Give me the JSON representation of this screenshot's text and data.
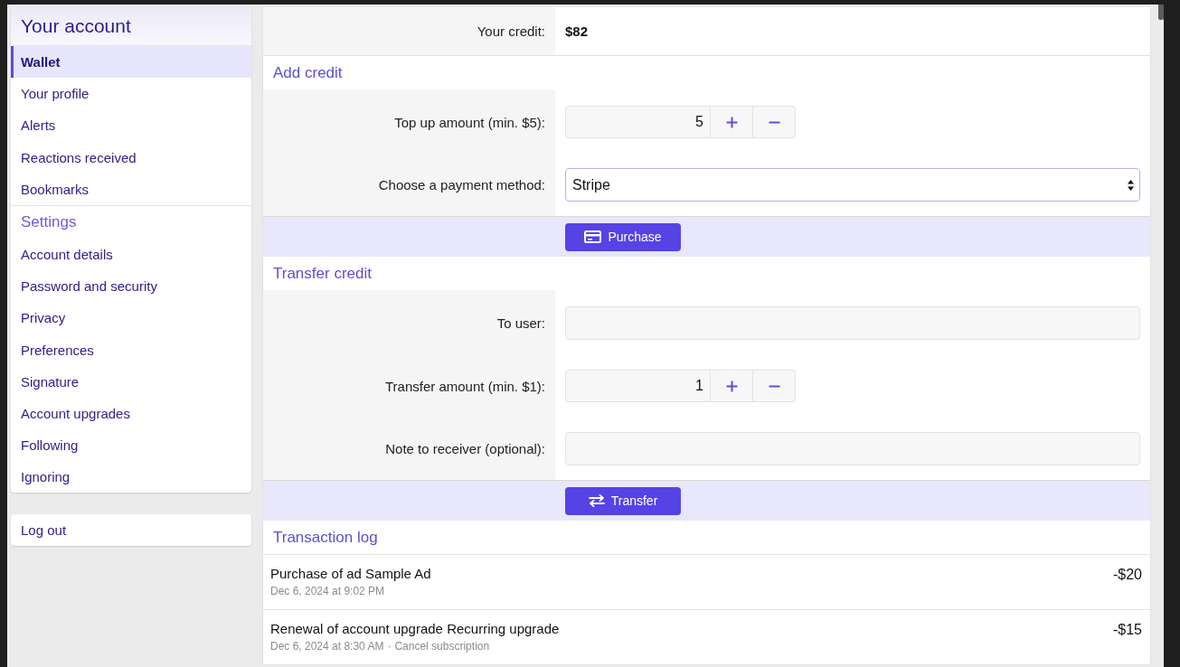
{
  "sidebar": {
    "sections": [
      {
        "kind": "title",
        "heading": "Your account",
        "items": [
          {
            "label": "Wallet",
            "selected": true
          },
          {
            "label": "Your profile",
            "selected": false
          },
          {
            "label": "Alerts",
            "selected": false
          },
          {
            "label": "Reactions received",
            "selected": false
          },
          {
            "label": "Bookmarks",
            "selected": false
          }
        ]
      },
      {
        "kind": "section",
        "heading": "Settings",
        "items": [
          {
            "label": "Account details",
            "selected": false
          },
          {
            "label": "Password and security",
            "selected": false
          },
          {
            "label": "Privacy",
            "selected": false
          },
          {
            "label": "Preferences",
            "selected": false
          },
          {
            "label": "Signature",
            "selected": false
          },
          {
            "label": "Account upgrades",
            "selected": false
          },
          {
            "label": "Following",
            "selected": false
          },
          {
            "label": "Ignoring",
            "selected": false
          }
        ]
      }
    ],
    "logout": "Log out"
  },
  "credit": {
    "label": "Your credit:",
    "value": "$82"
  },
  "forms": [
    {
      "heading": "Add credit",
      "fields": [
        {
          "kind": "stepper",
          "label": "Top up amount (min. $5):",
          "value": "5"
        },
        {
          "kind": "select",
          "label": "Choose a payment method:",
          "value": "Stripe"
        }
      ],
      "button": {
        "kind": "purchase",
        "label": "Purchase"
      }
    },
    {
      "heading": "Transfer credit",
      "fields": [
        {
          "kind": "text",
          "label": "To user:"
        },
        {
          "kind": "stepper",
          "label": "Transfer amount (min. $1):",
          "value": "1"
        },
        {
          "kind": "text",
          "label": "Note to receiver (optional):"
        }
      ],
      "button": {
        "kind": "transfer",
        "label": "Transfer"
      }
    }
  ],
  "transaction_log": {
    "heading": "Transaction log",
    "items": [
      {
        "title": "Purchase of ad Sample Ad",
        "date": "Dec 6, 2024 at 9:02 PM",
        "amount": "-$20"
      },
      {
        "title": "Renewal of account upgrade Recurring upgrade",
        "date": "Dec 6, 2024 at 8:30 AM",
        "separator": "·",
        "link": "Cancel subscription",
        "amount": "-$15"
      }
    ]
  }
}
